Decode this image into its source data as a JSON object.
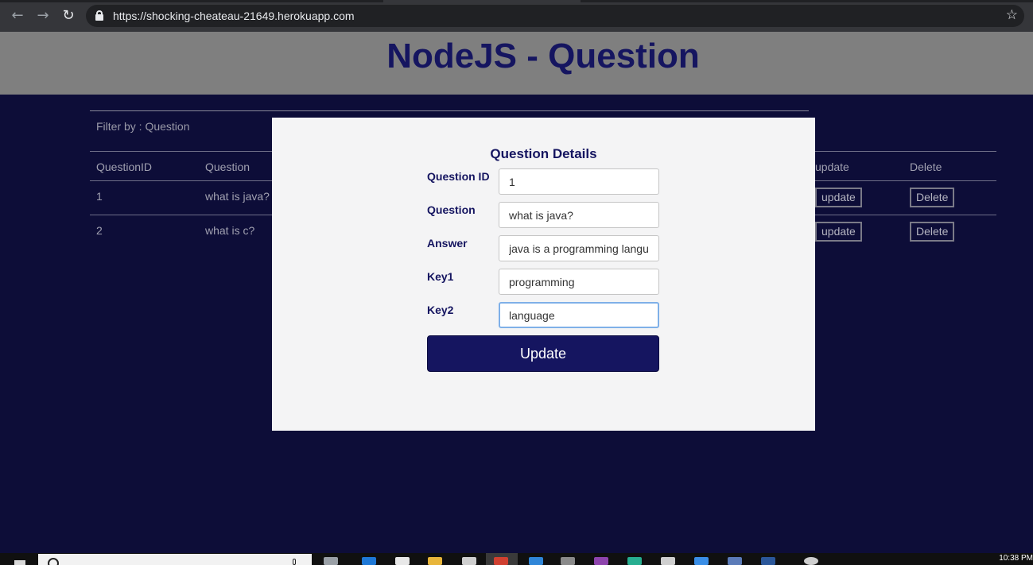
{
  "browser": {
    "url": "https://shocking-cheateau-21649.herokuapp.com",
    "back_icon": "←",
    "forward_icon": "→",
    "reload_icon": "↻",
    "bookmark_icon": "☆"
  },
  "page": {
    "title": "NodeJS - Question",
    "filter_label": "Filter by : Question",
    "columns": [
      "QuestionID",
      "Question",
      "update",
      "Delete"
    ],
    "rows": [
      {
        "id": "1",
        "question": "what is java?",
        "update_label": "update",
        "delete_label": "Delete"
      },
      {
        "id": "2",
        "question": "what is c?",
        "update_label": "update",
        "delete_label": "Delete"
      }
    ]
  },
  "modal": {
    "title": "Question Details",
    "fields": [
      {
        "label": "Question ID",
        "value": "1"
      },
      {
        "label": "Question",
        "value": "what is java?"
      },
      {
        "label": "Answer",
        "value": "java is a programming langu"
      },
      {
        "label": "Key1",
        "value": "programming"
      },
      {
        "label": "Key2",
        "value": "language"
      }
    ],
    "submit_label": "Update"
  },
  "taskbar": {
    "clock": "10:38 PM"
  },
  "colors": {
    "page_background": "#0d0d38",
    "header_band": "#7f7f7f",
    "accent_navy": "#151560",
    "modal_background": "#f4f4f5"
  }
}
